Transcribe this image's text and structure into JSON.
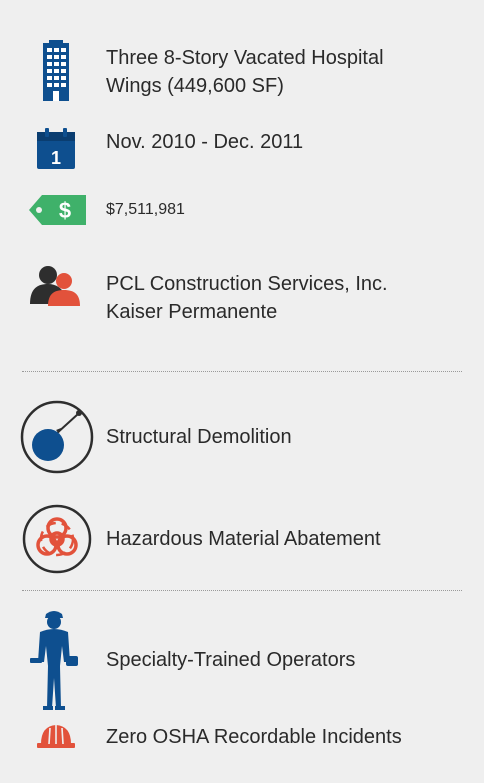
{
  "facts": {
    "building": "Three 8-Story Vacated Hospital Wings (449,600 SF)",
    "building_line1": "Three 8-Story Vacated Hospital",
    "building_line2": "Wings (449,600 SF)",
    "dates": "Nov. 2010 - Dec. 2011",
    "calendar_day": "1",
    "price_symbol": "$",
    "cost": "$7,511,981",
    "client_line1": "PCL Construction Services, Inc.",
    "client_line2": "Kaiser Permanente"
  },
  "services": {
    "demolition": "Structural Demolition",
    "abatement": "Hazardous Material Abatement"
  },
  "safety": {
    "operators": "Specialty-Trained Operators",
    "incidents": "Zero OSHA Recordable Incidents"
  },
  "icons": {
    "building": "building-icon",
    "calendar": "calendar-icon",
    "price_tag": "price-tag-icon",
    "people": "people-icon",
    "wrecking_ball": "wrecking-ball-icon",
    "biohazard": "biohazard-icon",
    "worker": "worker-icon",
    "hard_hat": "hard-hat-icon"
  },
  "colors": {
    "navy": "#0e4f8f",
    "green": "#3fb16a",
    "orange": "#e2523b",
    "text": "#2a2a2a",
    "background": "#efefef"
  }
}
